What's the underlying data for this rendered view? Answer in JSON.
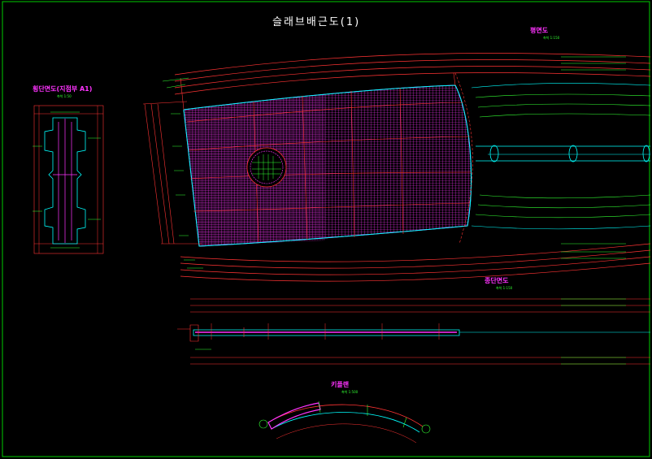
{
  "drawing": {
    "title": "슬래브배근도(1)",
    "views": {
      "plan": {
        "title": "평면도",
        "scale": "축척 1:150"
      },
      "cross_section": {
        "title": "횡단면도(지점부 A1)",
        "scale": "축척 1:50"
      },
      "longitudinal_section": {
        "title": "종단면도",
        "scale": "축척 1:150"
      },
      "key_plan": {
        "title": "키플랜",
        "scale": "축척 1:500"
      }
    }
  },
  "colors": {
    "background": "#000000",
    "border": "#00cc00",
    "rebar": "#ff33ff",
    "outline": "#00ffff",
    "dimension": "#ff3333",
    "text": "#33ff33",
    "title": "#ffffff"
  }
}
